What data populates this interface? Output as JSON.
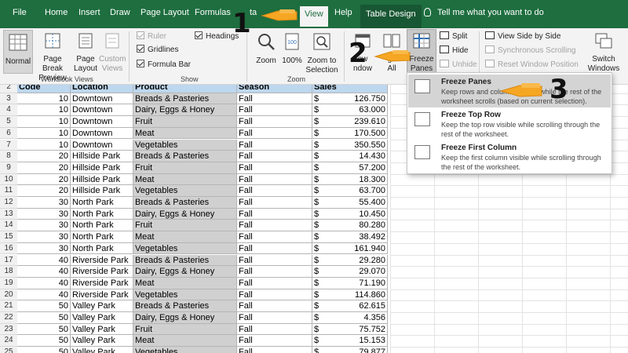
{
  "tabs": [
    "File",
    "Home",
    "Insert",
    "Draw",
    "Page Layout",
    "Formulas",
    "ta",
    "View",
    "Help",
    "Table Design"
  ],
  "tell_me": "Tell me what you want to do",
  "ribbon": {
    "workbook_views": {
      "label": "Workbook Views",
      "normal": "Normal",
      "page_break_1": "Page Break",
      "page_break_2": "Preview",
      "page_layout_1": "Page",
      "page_layout_2": "Layout",
      "custom_1": "Custom",
      "custom_2": "Views"
    },
    "show": {
      "label": "Show",
      "ruler": "Ruler",
      "gridlines": "Gridlines",
      "formula_bar": "Formula Bar",
      "headings": "Headings"
    },
    "zoom": {
      "label": "Zoom",
      "zoom": "Zoom",
      "hundred": "100%",
      "to_sel_1": "Zoom to",
      "to_sel_2": "Selection"
    },
    "window": {
      "new_window_1": "ew",
      "new_window_2": "ndow",
      "arrange_1": "ge",
      "arrange_2": "All",
      "freeze_1": "Freeze",
      "freeze_2": "Panes",
      "split": "Split",
      "hide": "Hide",
      "unhide": "Unhide",
      "side_by_side": "View Side by Side",
      "sync_scroll": "Synchronous Scrolling",
      "reset_pos": "Reset Window Position",
      "switch_1": "Switch",
      "switch_2": "Windows"
    }
  },
  "freeze_menu": {
    "items": [
      {
        "title": "Freeze Panes",
        "desc": "Keep rows and columns visible while the rest of the worksheet scrolls (based on current selection)."
      },
      {
        "title": "Freeze Top Row",
        "desc": "Keep the top row visible while scrolling through the rest of the worksheet."
      },
      {
        "title": "Freeze First Column",
        "desc": "Keep the first column visible while scrolling through the rest of the worksheet."
      }
    ]
  },
  "annotations": [
    "1",
    "2",
    "3"
  ],
  "table": {
    "headers": [
      "Code",
      "Location",
      "Product",
      "Season",
      "Sales"
    ],
    "currency": "$",
    "rows": [
      {
        "n": "2",
        "code": "",
        "loc": "",
        "prod": "",
        "season": "",
        "sales": ""
      },
      {
        "n": "3",
        "code": "10",
        "loc": "Downtown",
        "prod": "Breads & Pasteries",
        "season": "Fall",
        "sales": "126.750"
      },
      {
        "n": "4",
        "code": "10",
        "loc": "Downtown",
        "prod": "Dairy, Eggs & Honey",
        "season": "Fall",
        "sales": "63.000"
      },
      {
        "n": "5",
        "code": "10",
        "loc": "Downtown",
        "prod": "Fruit",
        "season": "Fall",
        "sales": "239.610"
      },
      {
        "n": "6",
        "code": "10",
        "loc": "Downtown",
        "prod": "Meat",
        "season": "Fall",
        "sales": "170.500"
      },
      {
        "n": "7",
        "code": "10",
        "loc": "Downtown",
        "prod": "Vegetables",
        "season": "Fall",
        "sales": "350.550"
      },
      {
        "n": "8",
        "code": "20",
        "loc": "Hillside Park",
        "prod": "Breads & Pasteries",
        "season": "Fall",
        "sales": "14.430"
      },
      {
        "n": "9",
        "code": "20",
        "loc": "Hillside Park",
        "prod": "Fruit",
        "season": "Fall",
        "sales": "57.200"
      },
      {
        "n": "10",
        "code": "20",
        "loc": "Hillside Park",
        "prod": "Meat",
        "season": "Fall",
        "sales": "18.300"
      },
      {
        "n": "11",
        "code": "20",
        "loc": "Hillside Park",
        "prod": "Vegetables",
        "season": "Fall",
        "sales": "63.700"
      },
      {
        "n": "12",
        "code": "30",
        "loc": "North Park",
        "prod": "Breads & Pasteries",
        "season": "Fall",
        "sales": "55.400"
      },
      {
        "n": "13",
        "code": "30",
        "loc": "North Park",
        "prod": "Dairy, Eggs & Honey",
        "season": "Fall",
        "sales": "10.450"
      },
      {
        "n": "14",
        "code": "30",
        "loc": "North Park",
        "prod": "Fruit",
        "season": "Fall",
        "sales": "80.280"
      },
      {
        "n": "15",
        "code": "30",
        "loc": "North Park",
        "prod": "Meat",
        "season": "Fall",
        "sales": "38.492"
      },
      {
        "n": "16",
        "code": "30",
        "loc": "North Park",
        "prod": "Vegetables",
        "season": "Fall",
        "sales": "161.940"
      },
      {
        "n": "17",
        "code": "40",
        "loc": "Riverside Park",
        "prod": "Breads & Pasteries",
        "season": "Fall",
        "sales": "29.280"
      },
      {
        "n": "18",
        "code": "40",
        "loc": "Riverside Park",
        "prod": "Dairy, Eggs & Honey",
        "season": "Fall",
        "sales": "29.070"
      },
      {
        "n": "19",
        "code": "40",
        "loc": "Riverside Park",
        "prod": "Meat",
        "season": "Fall",
        "sales": "71.190"
      },
      {
        "n": "20",
        "code": "40",
        "loc": "Riverside Park",
        "prod": "Vegetables",
        "season": "Fall",
        "sales": "114.860"
      },
      {
        "n": "21",
        "code": "50",
        "loc": "Valley Park",
        "prod": "Breads & Pasteries",
        "season": "Fall",
        "sales": "62.615"
      },
      {
        "n": "22",
        "code": "50",
        "loc": "Valley Park",
        "prod": "Dairy, Eggs & Honey",
        "season": "Fall",
        "sales": "4.356"
      },
      {
        "n": "23",
        "code": "50",
        "loc": "Valley Park",
        "prod": "Fruit",
        "season": "Fall",
        "sales": "75.752"
      },
      {
        "n": "24",
        "code": "50",
        "loc": "Valley Park",
        "prod": "Meat",
        "season": "Fall",
        "sales": "15.153"
      },
      {
        "n": "25",
        "code": "50",
        "loc": "Valley Park",
        "prod": "Vegetables",
        "season": "Fall",
        "sales": "79.877"
      }
    ]
  },
  "colors": {
    "ribbon_green": "#1e6e3f",
    "header_blue": "#bdd7ee",
    "product_gray": "#d0d0d0",
    "pointer_orange": "#f5a623"
  }
}
